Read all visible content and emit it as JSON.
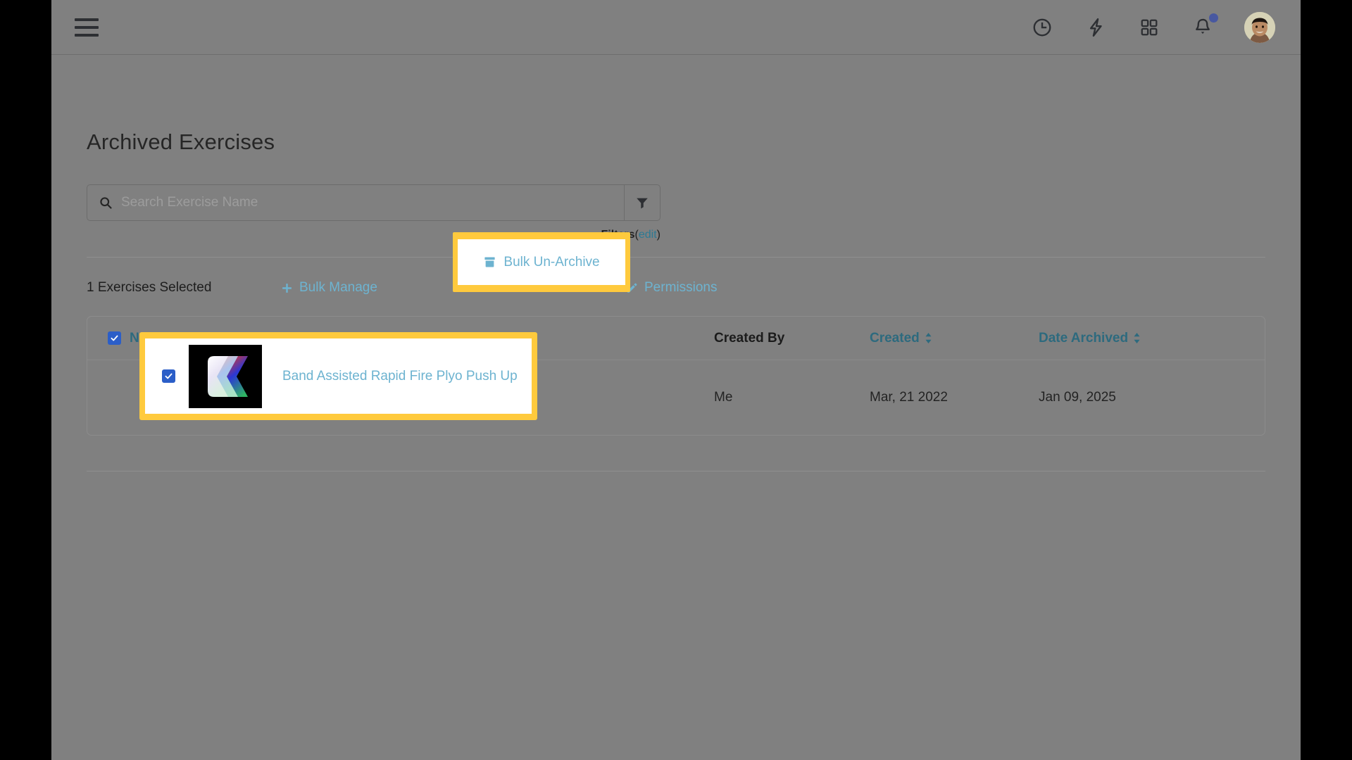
{
  "topbar": {
    "menu_icon": "hamburger-menu-icon",
    "icons": [
      {
        "name": "clock-icon",
        "label": "Recent"
      },
      {
        "name": "lightning-bolt-icon",
        "label": "Quick Actions"
      },
      {
        "name": "grid-apps-icon",
        "label": "Apps"
      },
      {
        "name": "bell-icon",
        "label": "Notifications",
        "has_dot": true
      }
    ],
    "avatar": "user-avatar",
    "notification_dot_color": "#4858a0"
  },
  "page": {
    "title": "Archived Exercises"
  },
  "search": {
    "placeholder": "Search Exercise Name",
    "value": "",
    "icon": "search-icon",
    "filter_icon": "funnel-filter-icon"
  },
  "filters": {
    "label": "Filters",
    "open_paren": "(",
    "edit": "edit",
    "close_paren": ")"
  },
  "actions": {
    "selected_count": "1 Exercises Selected",
    "bulk_manage": "Bulk Manage",
    "bulk_unarchive": "Bulk Un-Archive",
    "permissions": "Permissions"
  },
  "table": {
    "columns": [
      {
        "label": "Name",
        "sortable": true,
        "link": true
      },
      {
        "label": "Created By",
        "sortable": false,
        "link": false
      },
      {
        "label": "Created",
        "sortable": true,
        "link": true
      },
      {
        "label": "Date Archived",
        "sortable": true,
        "link": true
      }
    ],
    "rows": [
      {
        "selected": true,
        "name": "Band Assisted Rapid Fire Plyo Push Up",
        "created_by": "Me",
        "created": "Mar, 21 2022",
        "date_archived": "Jan 09, 2025",
        "thumbnail": "exercise-thumbnail"
      }
    ]
  },
  "colors": {
    "link": "#6db3d0",
    "header_link": "#2d6a7e",
    "highlight": "#ffca3d",
    "checkbox": "#2b5ec8",
    "page_bg": "#808080"
  }
}
